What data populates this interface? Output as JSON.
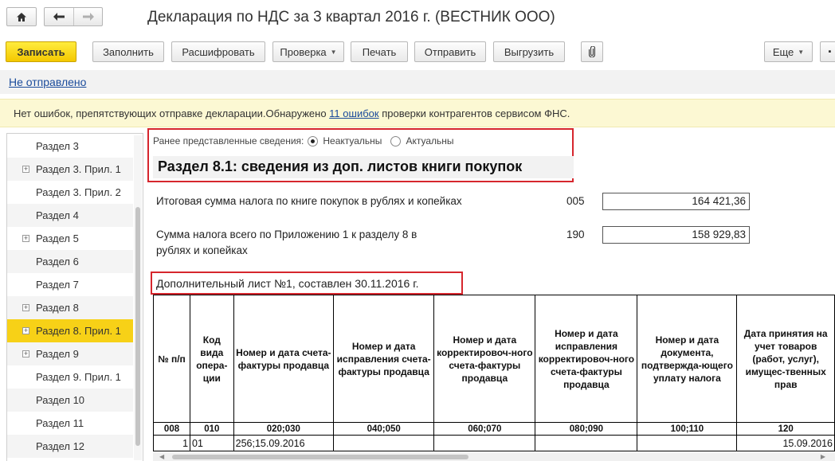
{
  "window": {
    "title": "Декларация по НДС за 3 квартал 2016 г. (ВЕСТНИК ООО)"
  },
  "toolbar": {
    "save": "Записать",
    "fill": "Заполнить",
    "decode": "Расшифровать",
    "check": "Проверка",
    "print": "Печать",
    "send": "Отправить",
    "upload": "Выгрузить",
    "more": "Еще"
  },
  "status": {
    "link": "Не отправлено"
  },
  "banner": {
    "text_before": "Нет ошибок, препятствующих отправке декларации.Обнаружено ",
    "link": "11 ошибок",
    "text_after": " проверки контрагентов сервисом ФНС."
  },
  "sidebar": {
    "items": [
      {
        "label": "Раздел 3",
        "expandable": false
      },
      {
        "label": "Раздел 3. Прил. 1",
        "expandable": true
      },
      {
        "label": "Раздел 3. Прил. 2",
        "expandable": false
      },
      {
        "label": "Раздел 4",
        "expandable": false
      },
      {
        "label": "Раздел 5",
        "expandable": true
      },
      {
        "label": "Раздел 6",
        "expandable": false
      },
      {
        "label": "Раздел 7",
        "expandable": false
      },
      {
        "label": "Раздел 8",
        "expandable": true
      },
      {
        "label": "Раздел 8. Прил. 1",
        "expandable": true,
        "active": true
      },
      {
        "label": "Раздел 9",
        "expandable": true
      },
      {
        "label": "Раздел 9. Прил. 1",
        "expandable": false
      },
      {
        "label": "Раздел 10",
        "expandable": false
      },
      {
        "label": "Раздел 11",
        "expandable": false
      },
      {
        "label": "Раздел 12",
        "expandable": false
      }
    ]
  },
  "form": {
    "prev_label": "Ранее представленные сведения:",
    "option_irrelevant": "Неактуальны",
    "option_relevant": "Актуальны",
    "selected_option": "Неактуальны",
    "section_title": "Раздел 8.1: сведения из доп. листов книги покупок",
    "row1_label": "Итоговая сумма налога по книге покупок в рублях и копейках",
    "row1_code": "005",
    "row1_value": "164 421,36",
    "row2_label_line1": "Сумма налога всего по Приложению 1 к разделу 8 в",
    "row2_label_line2": "рублях и копейках",
    "row2_code": "190",
    "row2_value": "158 929,83",
    "sheet_title": "Дополнительный лист №1, составлен 30.11.2016 г."
  },
  "table": {
    "headers": [
      "№ п/п",
      "Код вида опера-ции",
      "Номер и дата счета-фактуры продавца",
      "Номер и дата исправления счета-фактуры продавца",
      "Номер и дата корректировоч-ного счета-фактуры продавца",
      "Номер и дата исправления корректировоч-ного счета-фактуры продавца",
      "Номер и дата документа, подтвержда-ющего уплату налога",
      "Дата принятия на учет товаров (работ, услуг), имущес-твенных прав"
    ],
    "codes": [
      "008",
      "010",
      "020;030",
      "040;050",
      "060;070",
      "080;090",
      "100;110",
      "120"
    ],
    "rows": [
      [
        "1",
        "01",
        "256;15.09.2016",
        "",
        "",
        "",
        "",
        "15.09.2016"
      ]
    ]
  }
}
